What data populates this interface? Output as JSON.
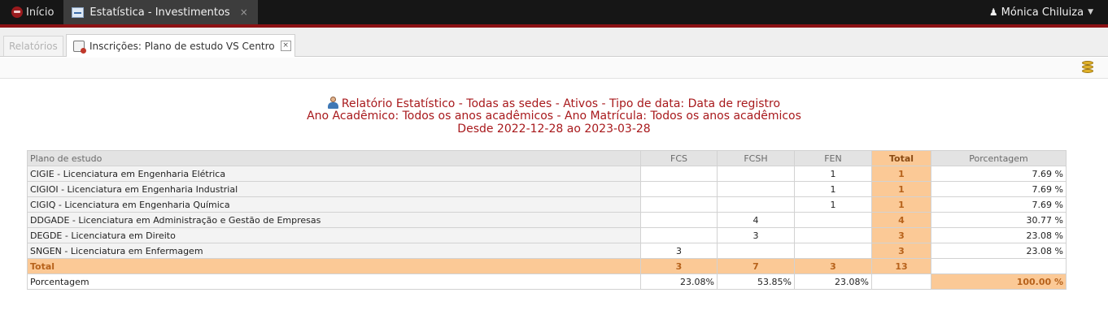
{
  "topbar": {
    "home_label": "Início",
    "app_tab_label": "Estatística - Investimentos",
    "app_tab_close": "×",
    "user_name": "Mónica Chiluiza"
  },
  "subtabs": {
    "inactive_label": "Relatórios",
    "active_label": "Inscrições: Plano de estudo VS Centro",
    "close": "×"
  },
  "report": {
    "line1": "Relatório Estatístico - Todas as sedes - Ativos - Tipo de data: Data de registro",
    "line2": "Ano Acadêmico: Todos os anos acadêmicos - Ano Matrícula: Todos os anos acadêmicos",
    "line3": "Desde 2022-12-28 ao 2023-03-28"
  },
  "table": {
    "headers": [
      "Plano de estudo",
      "FCS",
      "FCSH",
      "FEN",
      "Total",
      "Porcentagem"
    ],
    "rows": [
      [
        "CIGIE - Licenciatura em Engenharia Elétrica",
        "",
        "",
        "1",
        "1",
        "7.69 %"
      ],
      [
        "CIGIOI - Licenciatura em Engenharia Industrial",
        "",
        "",
        "1",
        "1",
        "7.69 %"
      ],
      [
        "CIGIQ - Licenciatura em Engenharia Química",
        "",
        "",
        "1",
        "1",
        "7.69 %"
      ],
      [
        "DDGADE - Licenciatura em Administração e Gestão de Empresas",
        "",
        "4",
        "",
        "4",
        "30.77 %"
      ],
      [
        "DEGDE - Licenciatura em Direito",
        "",
        "3",
        "",
        "3",
        "23.08 %"
      ],
      [
        "SNGEN - Licenciatura em Enfermagem",
        "3",
        "",
        "",
        "3",
        "23.08 %"
      ]
    ],
    "total_row": [
      "Total",
      "3",
      "7",
      "3",
      "13",
      ""
    ],
    "pct_row": [
      "Porcentagem",
      "23.08%",
      "53.85%",
      "23.08%",
      "",
      "100.00 %"
    ]
  },
  "colors": {
    "accent": "#a8191c",
    "topbar": "#161616",
    "total_fill": "#fbc996"
  },
  "icons": [
    "home-logo-icon",
    "chart-icon",
    "user-icon",
    "chevron-down-icon",
    "report-icon",
    "close-icon",
    "coins-icon",
    "person-icon"
  ]
}
